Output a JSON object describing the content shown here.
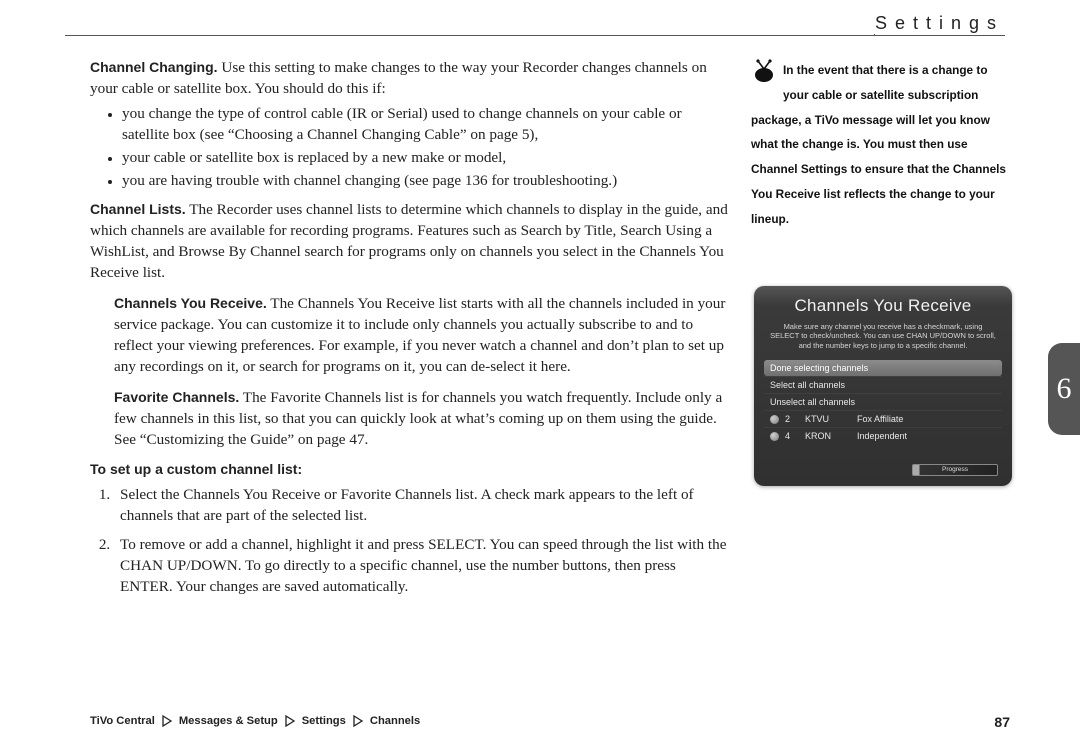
{
  "header": {
    "section_title": "Settings"
  },
  "side_tab": {
    "chapter_number": "6"
  },
  "page_number": "87",
  "main": {
    "channel_changing": {
      "heading": "Channel Changing.",
      "intro": " Use this setting to make changes to the way your Recorder changes channels on your cable or satellite box. You should do this if:",
      "bullets": [
        "you change the type of control cable (IR or Serial) used to change channels on your cable or satellite box (see “Choosing a Channel Changing Cable” on page 5),",
        "your cable or satellite box is replaced by a new make or model,",
        "you are having trouble with channel changing (see page 136 for troubleshooting.)"
      ]
    },
    "channel_lists": {
      "heading": "Channel Lists.",
      "body": " The Recorder uses channel lists to determine which channels to display in the guide, and which channels are available for recording programs. Features such as Search by Title, Search Using a WishList, and Browse By Channel search for programs only on channels you select in the Channels You Receive list."
    },
    "channels_you_receive": {
      "heading": "Channels You Receive.",
      "body": " The Channels You Receive list starts with all the channels included in your service package. You can customize it to include only channels you actually subscribe to and to reflect your viewing preferences. For example, if you never watch a channel and don’t plan to set up any recordings on it, or search for programs on it, you can de-select it here."
    },
    "favorite_channels": {
      "heading": "Favorite Channels.",
      "body": " The Favorite Channels list is for channels you watch frequently. Include only a few channels in this list, so that you can quickly look at what’s coming up on them using the guide. See “Customizing the Guide” on page 47."
    },
    "custom_list": {
      "heading": "To set up a custom channel list:",
      "steps": [
        "Select the Channels You Receive or Favorite Channels list. A check mark appears to the left of channels that are part of the selected list.",
        "To remove or add a channel, highlight it and press SELECT. You can speed through the list with the CHAN UP/DOWN. To go directly to a specific channel, use the number buttons, then press ENTER. Your changes are saved automatically."
      ]
    }
  },
  "sidebar_note": {
    "text": "In the event that there is a change to your cable or satellite subscription package, a TiVo message will let you know what the change is. You must then use Channel Settings to ensure that the Channels You Receive list reflects the change to your lineup."
  },
  "screenshot": {
    "title": "Channels You Receive",
    "subtitle": "Make sure any channel you receive has a checkmark, using SELECT to check/uncheck. You can use CHAN UP/DOWN to scroll, and the number keys to jump to a specific channel.",
    "rows": {
      "done": "Done selecting channels",
      "select_all": "Select all channels",
      "unselect_all": "Unselect all channels"
    },
    "channels": [
      {
        "num": "2",
        "call": "KTVU",
        "aff": "Fox Affiliate"
      },
      {
        "num": "4",
        "call": "KRON",
        "aff": "Independent"
      }
    ],
    "progress_label": "Progress"
  },
  "breadcrumb": {
    "items": [
      "TiVo Central",
      "Messages & Setup",
      "Settings",
      "Channels"
    ]
  }
}
